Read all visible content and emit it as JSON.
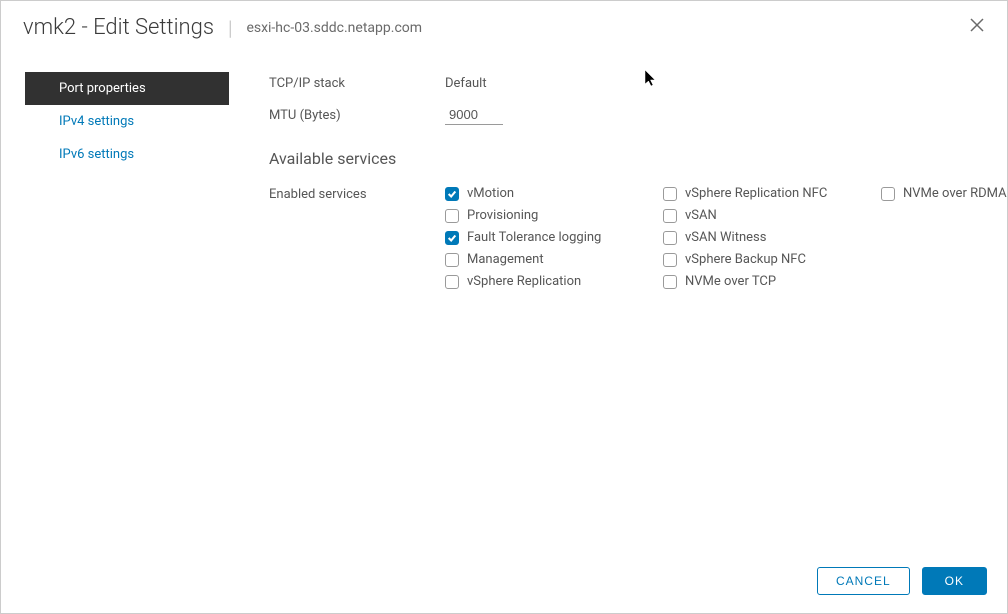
{
  "header": {
    "title": "vmk2 - Edit Settings",
    "subtitle": "esxi-hc-03.sddc.netapp.com"
  },
  "sidebar": {
    "items": [
      {
        "label": "Port properties",
        "active": true
      },
      {
        "label": "IPv4 settings",
        "active": false
      },
      {
        "label": "IPv6 settings",
        "active": false
      }
    ]
  },
  "form": {
    "tcpip_stack_label": "TCP/IP stack",
    "tcpip_stack_value": "Default",
    "mtu_label": "MTU (Bytes)",
    "mtu_value": "9000"
  },
  "available_services_title": "Available services",
  "enabled_services_label": "Enabled services",
  "services": {
    "col1": [
      {
        "label": "vMotion",
        "checked": true
      },
      {
        "label": "Provisioning",
        "checked": false
      },
      {
        "label": "Fault Tolerance logging",
        "checked": true
      },
      {
        "label": "Management",
        "checked": false
      },
      {
        "label": "vSphere Replication",
        "checked": false
      }
    ],
    "col2": [
      {
        "label": "vSphere Replication NFC",
        "checked": false
      },
      {
        "label": "vSAN",
        "checked": false
      },
      {
        "label": "vSAN Witness",
        "checked": false
      },
      {
        "label": "vSphere Backup NFC",
        "checked": false
      },
      {
        "label": "NVMe over TCP",
        "checked": false
      }
    ],
    "col3": [
      {
        "label": "NVMe over RDMA",
        "checked": false
      }
    ]
  },
  "footer": {
    "cancel_label": "Cancel",
    "ok_label": "OK"
  }
}
